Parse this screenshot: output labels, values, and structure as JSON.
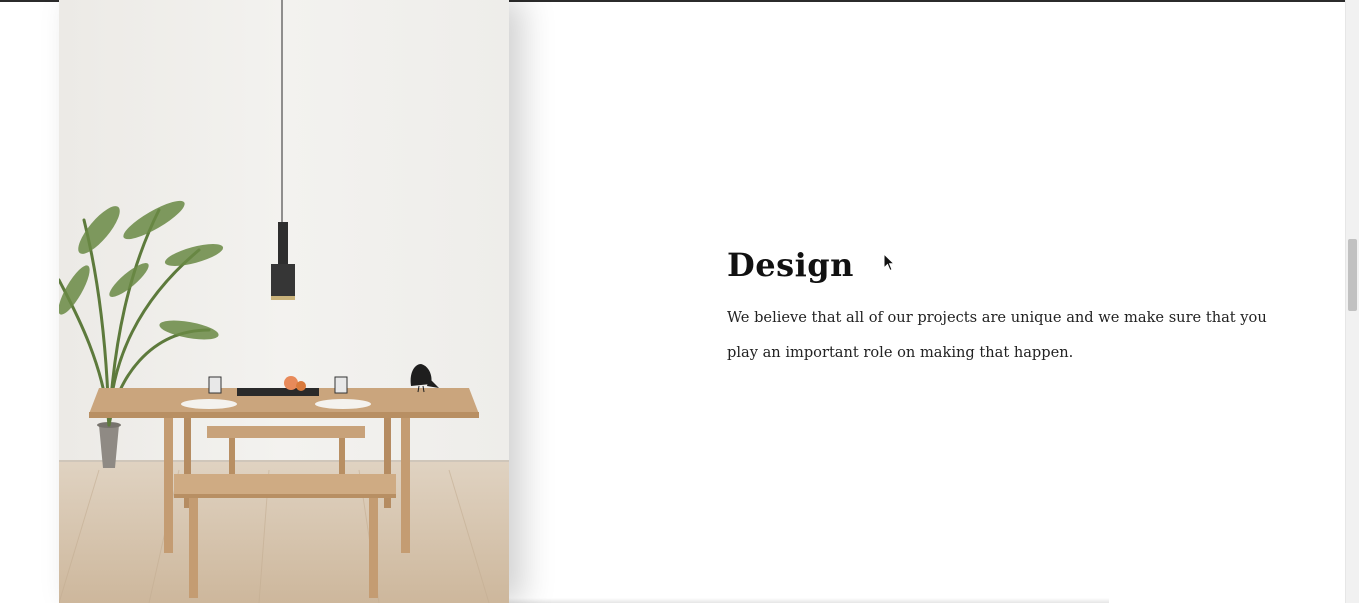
{
  "section": {
    "heading": "Design",
    "body": "We believe that all of our projects are unique and we make sure that you play an important role on making that happen."
  },
  "image": {
    "subject": "dining-room-photo",
    "colors": {
      "wall": "#efeeeb",
      "floor": "#d9c8b2",
      "wood": "#c9a27a",
      "lamp": "#2e2e2e",
      "plant": "#5d7a3c"
    }
  },
  "colors": {
    "background": "#ffffff",
    "text": "#111111",
    "scrollbar_track": "#f1f1f1",
    "scrollbar_thumb": "#c1c1c1"
  },
  "scroll": {
    "position_fraction": 0.4
  }
}
